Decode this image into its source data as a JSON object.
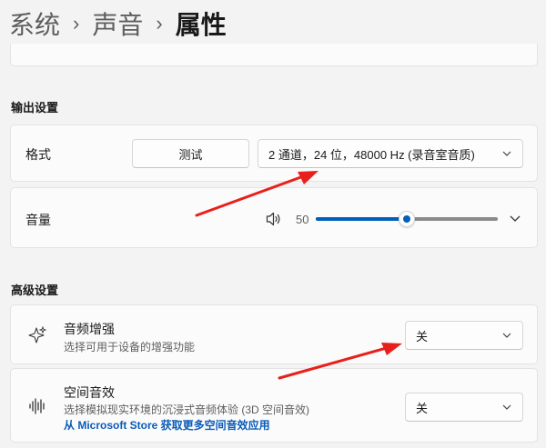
{
  "breadcrumb": {
    "items": [
      "系统",
      "声音"
    ],
    "current": "属性"
  },
  "output_settings": {
    "title": "输出设置",
    "format": {
      "label": "格式",
      "test_button": "测试",
      "selected": "2 通道，24 位，48000 Hz (录音室音质)"
    },
    "volume": {
      "label": "音量",
      "value": "50",
      "level_percent": 50
    }
  },
  "advanced_settings": {
    "title": "高级设置",
    "enhance": {
      "label": "音频增强",
      "description": "选择可用于设备的增强功能",
      "selected": "关",
      "icon": "sparkle-icon"
    },
    "spatial": {
      "label": "空间音效",
      "description": "选择模拟现实环境的沉浸式音频体验 (3D 空间音效)",
      "link": "从 Microsoft Store 获取更多空间音效应用",
      "selected": "关",
      "icon": "audio-wave-icon"
    }
  },
  "colors": {
    "accent": "#005fb8",
    "annotation_arrow": "#e8201b"
  }
}
